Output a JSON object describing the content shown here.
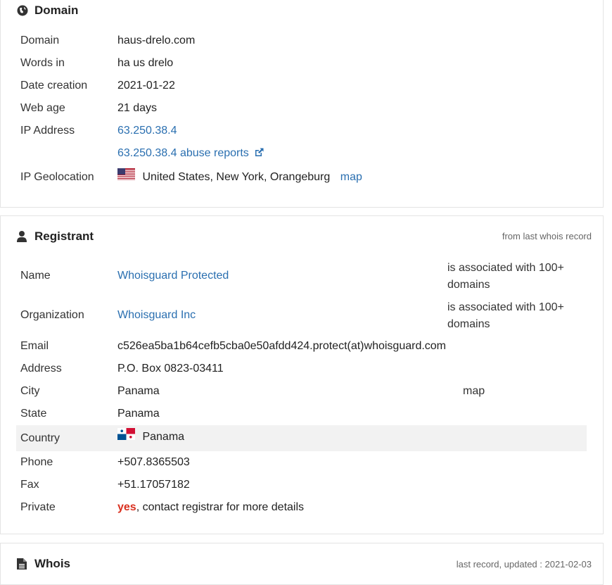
{
  "domain": {
    "title": "Domain",
    "rows": {
      "domain": {
        "label": "Domain",
        "value": "haus-drelo.com"
      },
      "words": {
        "label": "Words in",
        "value": "ha us drelo"
      },
      "date_creation": {
        "label": "Date creation",
        "value": "2021-01-22"
      },
      "web_age": {
        "label": "Web age",
        "value": "21 days"
      },
      "ip": {
        "label": "IP Address",
        "value": "63.250.38.4",
        "abuse": "63.250.38.4 abuse reports"
      },
      "geo": {
        "label": "IP Geolocation",
        "value": "United States, New York, Orangeburg",
        "map": "map"
      }
    }
  },
  "registrant": {
    "title": "Registrant",
    "note": "from last whois record",
    "rows": {
      "name": {
        "label": "Name",
        "value": "Whoisguard Protected",
        "assoc_1": "is associated with 100+",
        "assoc_2": "domains"
      },
      "org": {
        "label": "Organization",
        "value": "Whoisguard Inc",
        "assoc_1": "is associated with 100+",
        "assoc_2": "domains"
      },
      "email": {
        "label": "Email",
        "value": "c526ea5ba1b64cefb5cba0e50afdd424.protect(at)whoisguard.com"
      },
      "address": {
        "label": "Address",
        "value": "P.O. Box 0823-03411"
      },
      "city": {
        "label": "City",
        "value": "Panama",
        "map": "map"
      },
      "state": {
        "label": "State",
        "value": "Panama"
      },
      "country": {
        "label": "Country",
        "value": "Panama"
      },
      "phone": {
        "label": "Phone",
        "value": "+507.8365503"
      },
      "fax": {
        "label": "Fax",
        "value": "+51.17057182"
      },
      "private": {
        "label": "Private",
        "value_emph": "yes",
        "value_rest": ", contact registrar for more details"
      }
    }
  },
  "whois": {
    "title": "Whois",
    "note": "last record, updated : 2021-02-03"
  },
  "icons": {
    "domain": "globe-icon",
    "registrant": "user-icon",
    "whois": "document-icon",
    "external": "external-link-icon"
  },
  "colors": {
    "link": "#2a6fb0",
    "private_yes": "#d9301f",
    "highlight_row": "#f2f2f2"
  }
}
